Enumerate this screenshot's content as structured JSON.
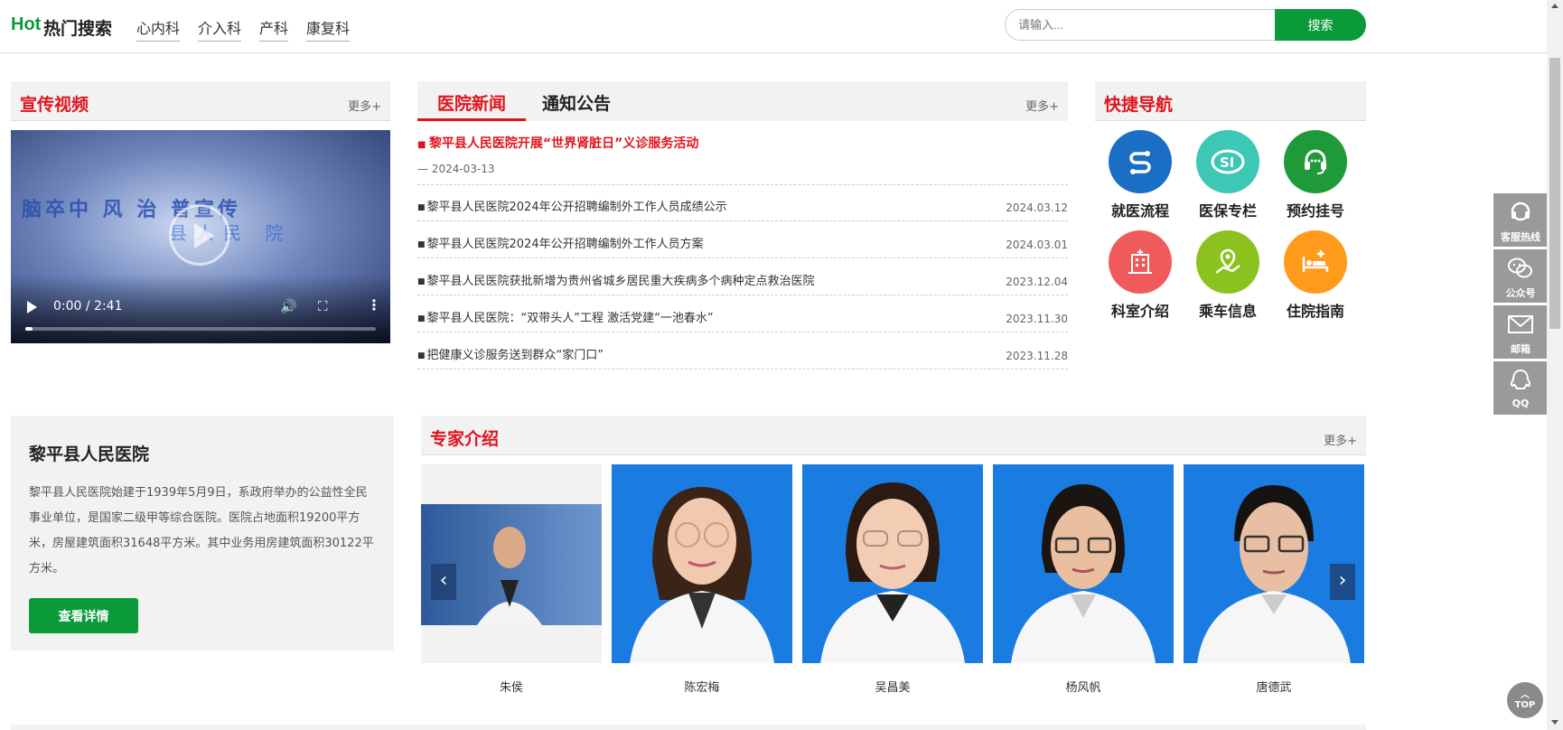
{
  "header": {
    "hot_badge": "Hot",
    "hot_label": "热门搜索",
    "hot_links": [
      "心内科",
      "介入科",
      "产科",
      "康复科"
    ],
    "search_placeholder": "请输入...",
    "search_button": "搜索"
  },
  "video_section": {
    "title": "宣传视频",
    "more": "更多+",
    "video_overlay_text": "脑卒中  风  治  普宣传",
    "video_overlay_sub": "县人民  院",
    "current_time": "0:00 / 2:41"
  },
  "news": {
    "tabs": [
      "医院新闻",
      "通知公告"
    ],
    "more": "更多+",
    "headline": "黎平县人民医院开展“世界肾脏日”义诊服务活动",
    "headline_date": "— 2024-03-13",
    "items": [
      {
        "title": "黎平县人民医院2024年公开招聘编制外工作人员成绩公示",
        "date": "2024.03.12"
      },
      {
        "title": "黎平县人民医院2024年公开招聘编制外工作人员方案",
        "date": "2024.03.01"
      },
      {
        "title": "黎平县人民医院获批新增为贵州省城乡居民重大疾病多个病种定点救治医院",
        "date": "2023.12.04"
      },
      {
        "title": "黎平县人民医院：“双带头人”工程 激活党建“一池春水”",
        "date": "2023.11.30"
      },
      {
        "title": "把健康义诊服务送到群众“家门口”",
        "date": "2023.11.28"
      }
    ]
  },
  "quick_nav": {
    "title": "快捷导航",
    "items": [
      {
        "label": "就医流程",
        "icon": "route-icon",
        "color": "#1a6fc4"
      },
      {
        "label": "医保专栏",
        "icon": "insurance-icon",
        "color": "#3cc8b4"
      },
      {
        "label": "预约挂号",
        "icon": "headset-icon",
        "color": "#1f9a3a"
      },
      {
        "label": "科室介绍",
        "icon": "building-icon",
        "color": "#f05a5a"
      },
      {
        "label": "乘车信息",
        "icon": "map-pin-icon",
        "color": "#8cc21f"
      },
      {
        "label": "住院指南",
        "icon": "hospital-bed-icon",
        "color": "#ff9a1a"
      }
    ]
  },
  "intro": {
    "title": "黎平县人民医院",
    "description": "黎平县人民医院始建于1939年5月9日，系政府举办的公益性全民事业单位，是国家二级甲等综合医院。医院占地面积19200平方米，房屋建筑面积31648平方米。其中业务用房建筑面积30122平方米。",
    "button": "查看详情"
  },
  "experts": {
    "title": "专家介绍",
    "more": "更多+",
    "names": [
      "朱侯",
      "陈宏梅",
      "吴昌美",
      "杨风帆",
      "唐德武"
    ]
  },
  "float_bar": {
    "items": [
      {
        "label": "客服热线",
        "icon": "headset-icon"
      },
      {
        "label": "公众号",
        "icon": "wechat-icon"
      },
      {
        "label": "邮箱",
        "icon": "mail-icon"
      },
      {
        "label": "QQ",
        "icon": "qq-icon"
      }
    ],
    "top_label": "TOP"
  }
}
